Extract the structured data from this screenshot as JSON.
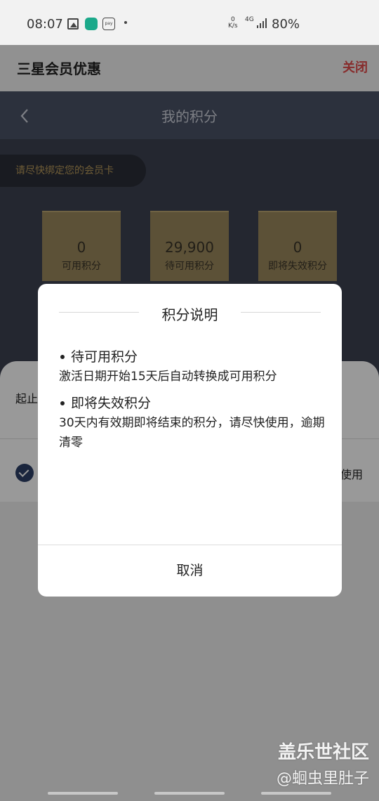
{
  "status_bar": {
    "time": "08:07",
    "net_speed_value": "0",
    "net_speed_unit": "K/s",
    "network_type": "4G",
    "battery": "80%",
    "pay_icon_text": "pay"
  },
  "header": {
    "title": "三星会员优惠",
    "close_label": "关闭",
    "close_color": "#e14a4a"
  },
  "page": {
    "nav_title": "我的积分",
    "bind_prompt": "请尽快绑定您的会员卡",
    "cards": [
      {
        "value": "0",
        "label": "可用积分"
      },
      {
        "value": "29,900",
        "label": "待可用积分"
      },
      {
        "value": "0",
        "label": "即将失效积分"
      }
    ],
    "sheet_label": "起止",
    "sheet_use_text": "使用"
  },
  "dialog": {
    "title": "积分说明",
    "sections": [
      {
        "title": "待可用积分",
        "text": "激活日期开始15天后自动转换成可用积分"
      },
      {
        "title": "即将失效积分",
        "text": "30天内有效期即将结束的积分，请尽快使用，逾期清零"
      }
    ],
    "cancel_label": "取消"
  },
  "watermark": {
    "line1": "盖乐世社区",
    "line2": "@蛔虫里肚子"
  }
}
